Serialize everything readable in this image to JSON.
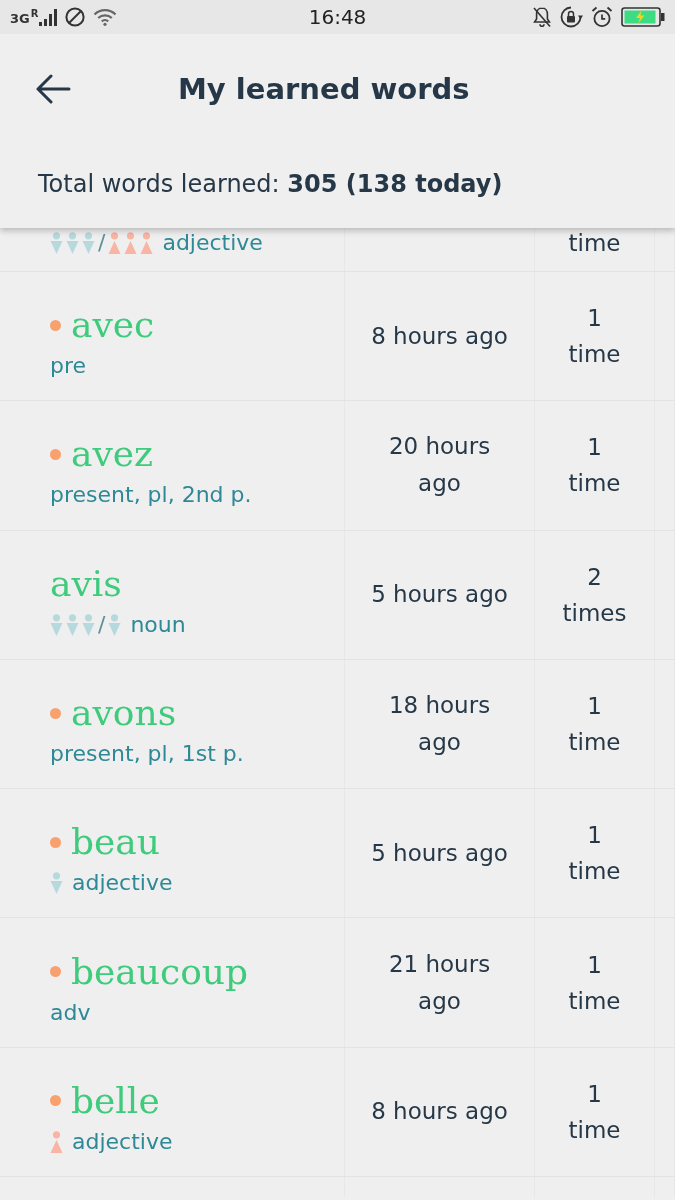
{
  "status_bar": {
    "network": "3G",
    "roaming": "R",
    "time": "16:48"
  },
  "header": {
    "title": "My learned words",
    "summary": "Total words learned: **305 (138 today)**"
  },
  "rows": [
    {
      "gender": {
        "forms": [
          {
            "kind": "masc_plural"
          },
          {
            "kind": "fem_plural"
          }
        ],
        "separator": "/"
      },
      "info": "adjective",
      "count": "time"
    },
    {
      "word": "avec",
      "marked": true,
      "info": "pre",
      "last_seen": "8 hours ago",
      "count": "1 time"
    },
    {
      "word": "avez",
      "marked": true,
      "info": "present, pl, 2nd p.",
      "last_seen": "20 hours ago",
      "count": "1 time"
    },
    {
      "word": "avis",
      "marked": false,
      "gender": {
        "forms": [
          {
            "kind": "masc_plural"
          },
          {
            "kind": "masc_singular"
          }
        ],
        "separator": "/"
      },
      "info": "noun",
      "last_seen": "5 hours ago",
      "count": "2 times"
    },
    {
      "word": "avons",
      "marked": true,
      "info": "present, pl, 1st p.",
      "last_seen": "18 hours ago",
      "count": "1 time"
    },
    {
      "word": "beau",
      "marked": true,
      "gender": {
        "forms": [
          {
            "kind": "masc_singular"
          }
        ]
      },
      "info": "adjective",
      "last_seen": "5 hours ago",
      "count": "1 time"
    },
    {
      "word": "beaucoup",
      "marked": true,
      "info": "adv",
      "last_seen": "21 hours ago",
      "count": "1 time"
    },
    {
      "word": "belle",
      "marked": true,
      "gender": {
        "forms": [
          {
            "kind": "fem_singular"
          }
        ]
      },
      "info": "adjective",
      "last_seen": "8 hours ago",
      "count": "1 time"
    }
  ]
}
